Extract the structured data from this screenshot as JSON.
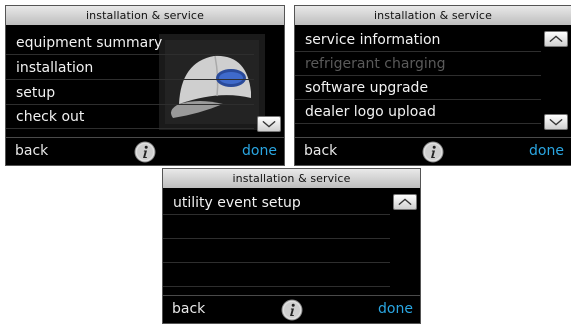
{
  "screens": [
    {
      "title": "installation & service",
      "items": [
        "equipment summary",
        "installation",
        "setup",
        "check out"
      ],
      "scroll": "down",
      "back_label": "back",
      "done_label": "done"
    },
    {
      "title": "installation & service",
      "items": [
        "service information",
        "refrigerant charging",
        "software upgrade",
        "dealer logo upload"
      ],
      "disabled_items": [
        "refrigerant charging"
      ],
      "scroll": "up-down",
      "back_label": "back",
      "done_label": "done"
    },
    {
      "title": "installation & service",
      "items": [
        "utility event setup"
      ],
      "scroll": "up",
      "back_label": "back",
      "done_label": "done"
    }
  ],
  "colors": {
    "done": "#2aa6e2",
    "title_bar": "#d6d6d6",
    "disabled_text": "#5a5a5a",
    "screen_bg": "#000000"
  },
  "icons": {
    "info": "info-icon",
    "scroll_up": "chevron-up-icon",
    "scroll_down": "chevron-down-icon",
    "background_graphic": "service-cap-icon"
  }
}
